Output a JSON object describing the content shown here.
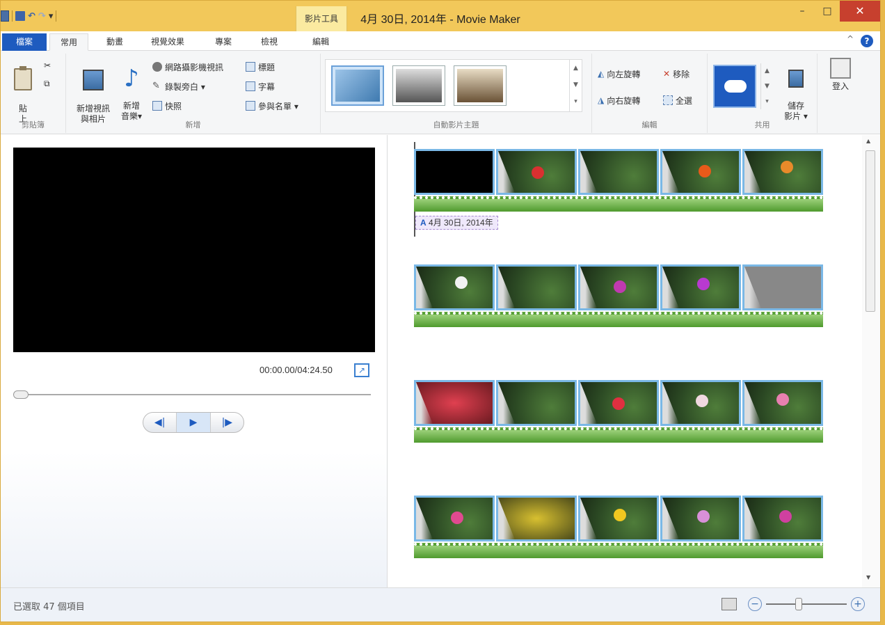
{
  "window": {
    "title": "4月 30日, 2014年 - Movie Maker",
    "context_tab": "影片工具",
    "controls": {
      "minimize": "–",
      "maximize": "□",
      "close": "✕"
    }
  },
  "tabs": [
    {
      "label": "檔案"
    },
    {
      "label": "常用"
    },
    {
      "label": "動畫"
    },
    {
      "label": "視覺效果"
    },
    {
      "label": "專案"
    },
    {
      "label": "檢視"
    },
    {
      "label": "編輯"
    }
  ],
  "help_label": "?",
  "collapse_label": "^",
  "ribbon": {
    "clipboard": {
      "label": "剪貼簿",
      "paste": "貼\n上"
    },
    "add": {
      "label": "新增",
      "add_media": "新增視訊\n與相片",
      "add_music": "新增\n音樂▾",
      "webcam": "網路攝影機視訊",
      "narration": "錄製旁白 ▾",
      "snapshot": "快照",
      "title": "標題",
      "caption": "字幕",
      "credits": "參與名單 ▾"
    },
    "themes": {
      "label": "自動影片主題"
    },
    "edit": {
      "label": "編輯",
      "rotate_left": "向左旋轉",
      "rotate_right": "向右旋轉",
      "remove": "移除",
      "select_all": "全選"
    },
    "share": {
      "label": "共用",
      "save_movie": "儲存\n影片 ▾"
    },
    "sign_in": "登入"
  },
  "preview": {
    "timecode": "00:00.00/04:24.50",
    "progress_fraction": 0,
    "transport": {
      "prev": "◀|",
      "play": "▶",
      "next": "|▶"
    }
  },
  "storyboard": {
    "caption_text": "4月 30日, 2014年",
    "caption_icon": "A"
  },
  "status": {
    "text": "已選取 47 個項目",
    "zoom_fraction": 0.4
  }
}
